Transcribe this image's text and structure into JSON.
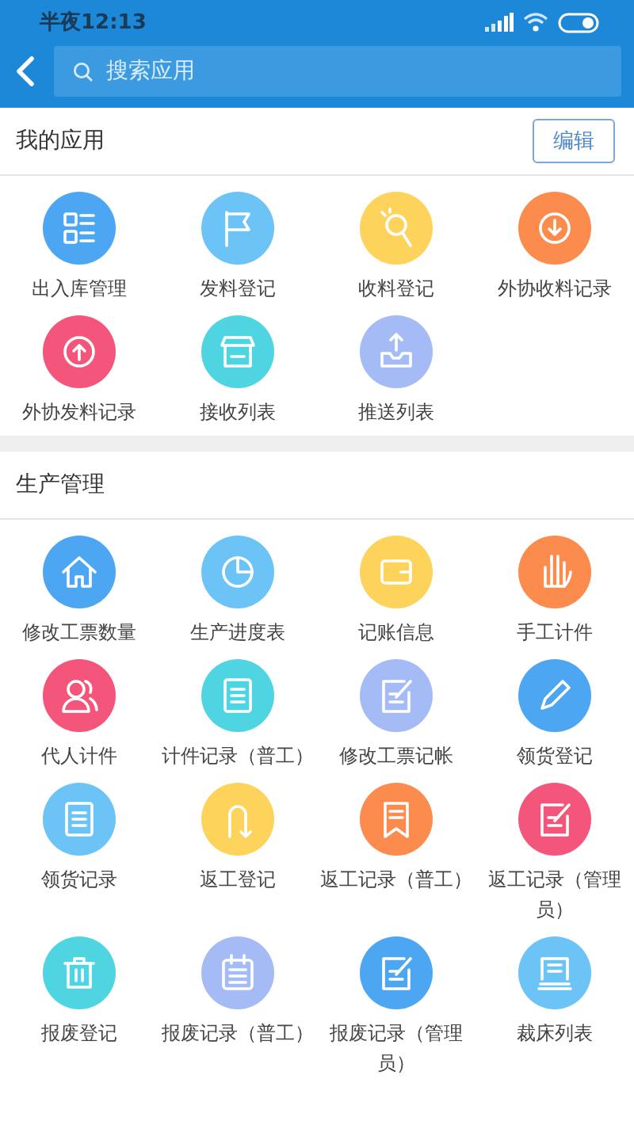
{
  "status_bar": {
    "time": "半夜12:13"
  },
  "search": {
    "placeholder": "搜索应用"
  },
  "sections": [
    {
      "title": "我的应用",
      "action": "编辑",
      "apps": [
        {
          "label": "出入库管理",
          "color": "#4da6f1"
        },
        {
          "label": "发料登记",
          "color": "#6cc4f6"
        },
        {
          "label": "收料登记",
          "color": "#fdd35b"
        },
        {
          "label": "外协收料记录",
          "color": "#fc8b4e"
        },
        {
          "label": "外协发料记录",
          "color": "#f3567a"
        },
        {
          "label": "接收列表",
          "color": "#4fd4e1"
        },
        {
          "label": "推送列表",
          "color": "#a5bbf6"
        }
      ]
    },
    {
      "title": "生产管理",
      "apps": [
        {
          "label": "修改工票数量",
          "color": "#4da6f1"
        },
        {
          "label": "生产进度表",
          "color": "#6cc4f6"
        },
        {
          "label": "记账信息",
          "color": "#fdd35b"
        },
        {
          "label": "手工计件",
          "color": "#fc8b4e"
        },
        {
          "label": "代人计件",
          "color": "#f3567a"
        },
        {
          "label": "计件记录（普工）",
          "color": "#4fd4e1"
        },
        {
          "label": "修改工票记帐",
          "color": "#a5bbf6"
        },
        {
          "label": "领货登记",
          "color": "#4da6f1"
        },
        {
          "label": "领货记录",
          "color": "#6cc4f6"
        },
        {
          "label": "返工登记",
          "color": "#fdd35b"
        },
        {
          "label": "返工记录（普工）",
          "color": "#fc8b4e"
        },
        {
          "label": "返工记录（管理员）",
          "color": "#f3567a"
        },
        {
          "label": "报废登记",
          "color": "#4fd4e1"
        },
        {
          "label": "报废记录（普工）",
          "color": "#a5bbf6"
        },
        {
          "label": "报废记录（管理员）",
          "color": "#4da6f1"
        },
        {
          "label": "裁床列表",
          "color": "#6cc4f6"
        }
      ]
    }
  ]
}
